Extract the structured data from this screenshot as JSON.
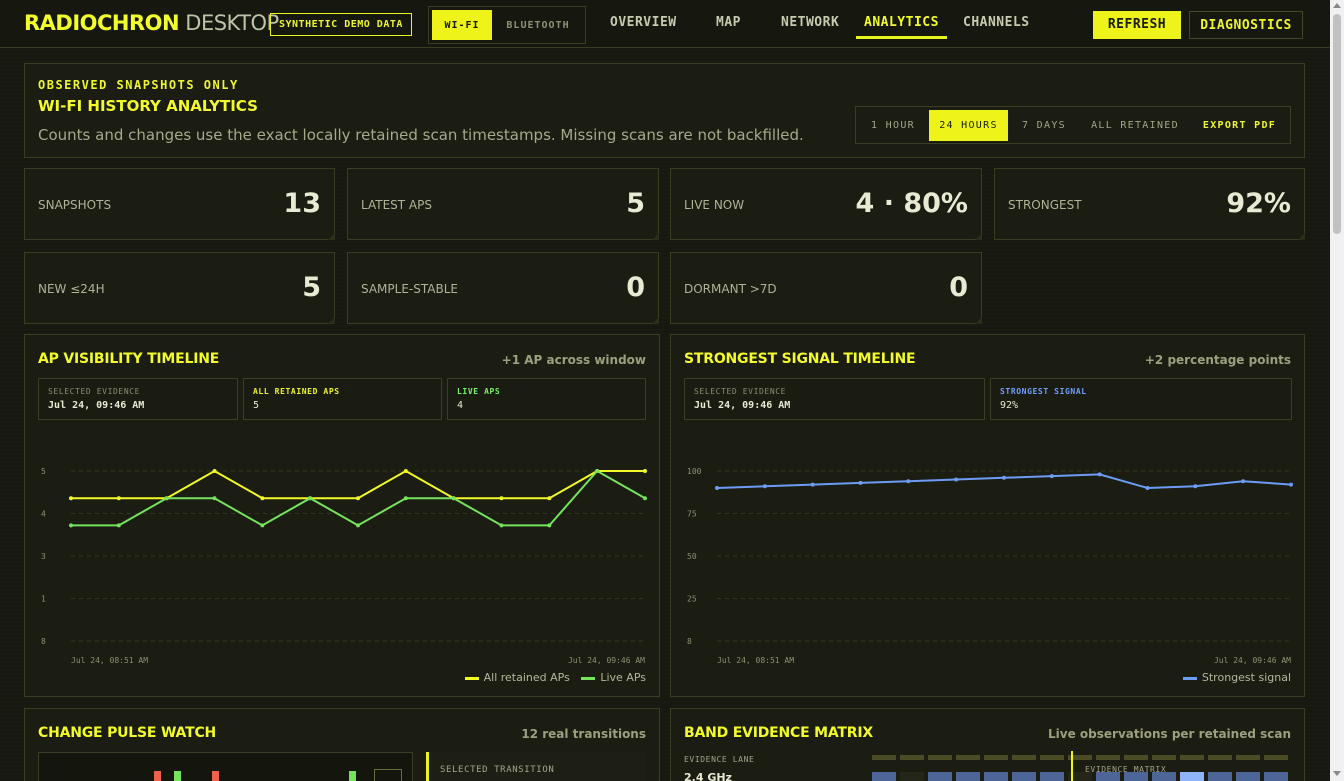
{
  "app": {
    "brand": "RADIOCHRON",
    "brand_suffix": " DESKTOP",
    "demo_badge": "SYNTHETIC DEMO DATA"
  },
  "radio_toggle": {
    "wifi": "WI-FI",
    "bluetooth": "BLUETOOTH",
    "selected": "WI-FI"
  },
  "nav": {
    "overview": "OVERVIEW",
    "map": "MAP",
    "network": "NETWORK",
    "analytics": "ANALYTICS",
    "channels": "CHANNELS",
    "active": "ANALYTICS"
  },
  "actions": {
    "refresh": "REFRESH",
    "diagnostics": "DIAGNOSTICS"
  },
  "header": {
    "kicker": "OBSERVED SNAPSHOTS ONLY",
    "title": "WI-FI HISTORY ANALYTICS",
    "description": "Counts and changes use the exact locally retained scan timestamps. Missing scans are not backfilled.",
    "ranges": [
      "1 HOUR",
      "24 HOURS",
      "7 DAYS",
      "ALL RETAINED"
    ],
    "selected_range": "24 HOURS",
    "export": "EXPORT PDF"
  },
  "stats": [
    {
      "label": "SNAPSHOTS",
      "value": "13"
    },
    {
      "label": "LATEST APS",
      "value": "5"
    },
    {
      "label": "LIVE NOW",
      "value": "4 · 80%"
    },
    {
      "label": "STRONGEST",
      "value": "92%"
    },
    {
      "label": "NEW ≤24H",
      "value": "5"
    },
    {
      "label": "SAMPLE-STABLE",
      "value": "0"
    },
    {
      "label": "DORMANT >7D",
      "value": "0"
    }
  ],
  "ap_panel": {
    "title": "AP VISIBILITY TIMELINE",
    "note": "+1 AP across window",
    "ev1_key": "SELECTED EVIDENCE",
    "ev1_val": "Jul 24, 09:46 AM",
    "ev2_key": "ALL RETAINED APS",
    "ev2_val": "5",
    "ev3_key": "LIVE APS",
    "ev3_val": "4",
    "legend_all": "All retained APs",
    "legend_live": "Live APs"
  },
  "sig_panel": {
    "title": "STRONGEST SIGNAL TIMELINE",
    "note": "+2 percentage points",
    "ev1_key": "SELECTED EVIDENCE",
    "ev1_val": "Jul 24, 09:46 AM",
    "ev2_key": "STRONGEST SIGNAL",
    "ev2_val": "92%",
    "legend": "Strongest signal"
  },
  "pulse_panel": {
    "title": "CHANGE PULSE WATCH",
    "note": "12 real transitions",
    "selected_transition": "SELECTED TRANSITION"
  },
  "band_panel": {
    "title": "BAND EVIDENCE MATRIX",
    "note": "Live observations per retained scan",
    "lane_label": "EVIDENCE LANE",
    "band": "2.4 GHz",
    "matrix_label": "EVIDENCE MATRIX"
  },
  "chart_data": [
    {
      "type": "line",
      "yticks": [
        "8",
        "1",
        "3",
        "4",
        "5"
      ],
      "ylim": [
        0,
        5
      ],
      "x_start": "Jul 24, 08:51 AM",
      "x_end": "Jul 24, 09:46 AM",
      "grid": true,
      "series": [
        {
          "name": "All retained APs",
          "color": "#f2fa25",
          "values": [
            4.2,
            4.2,
            4.2,
            5,
            4.2,
            4.2,
            4.2,
            5,
            4.2,
            4.2,
            4.2,
            5,
            5
          ]
        },
        {
          "name": "Live APs",
          "color": "#76e35c",
          "values": [
            3.4,
            3.4,
            4.2,
            4.2,
            3.4,
            4.2,
            3.4,
            4.2,
            4.2,
            3.4,
            3.4,
            5,
            4.2
          ]
        }
      ]
    },
    {
      "type": "line",
      "yticks": [
        "8",
        "25",
        "50",
        "75",
        "100"
      ],
      "ylim": [
        0,
        100
      ],
      "x_start": "Jul 24, 08:51 AM",
      "x_end": "Jul 24, 09:46 AM",
      "grid": true,
      "series": [
        {
          "name": "Strongest signal",
          "color": "#6d9cf5",
          "values": [
            90,
            91,
            92,
            93,
            94,
            95,
            96,
            97,
            98,
            90,
            91,
            94,
            92
          ]
        }
      ]
    }
  ]
}
